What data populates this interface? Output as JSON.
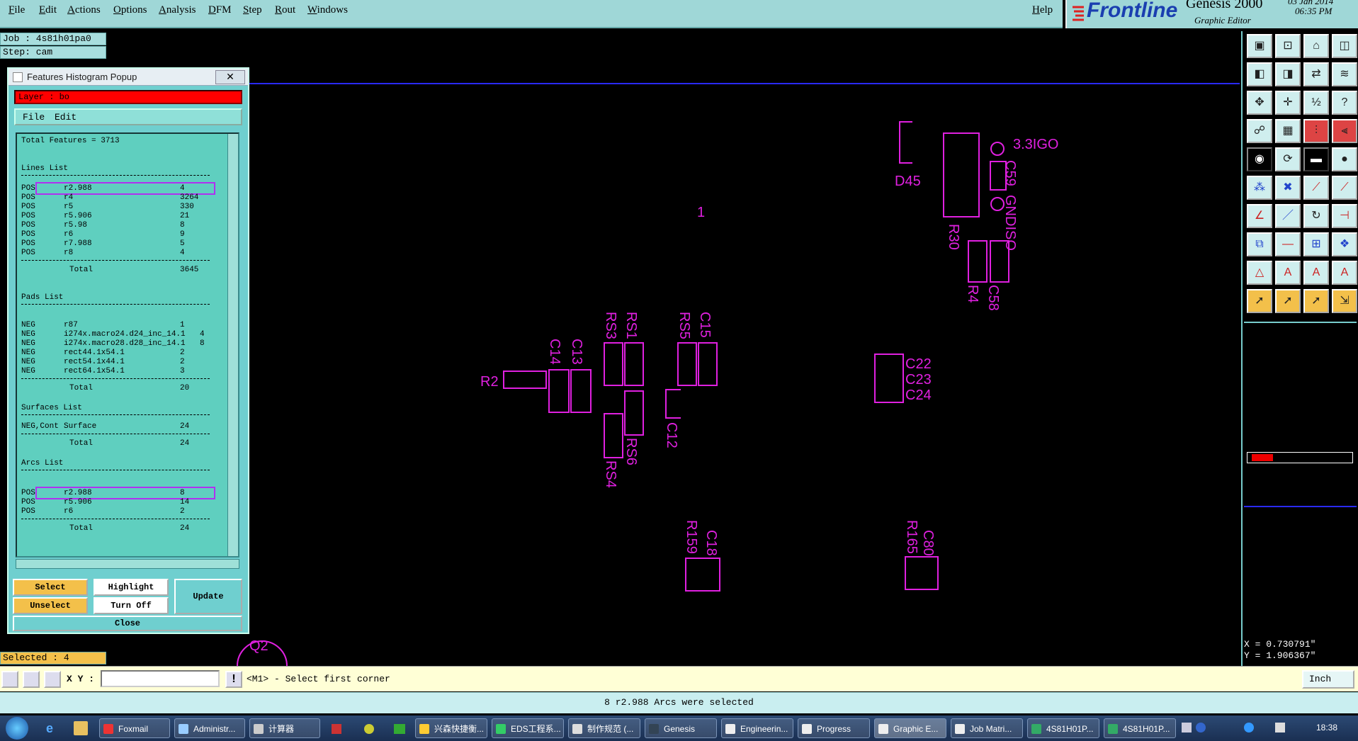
{
  "menu": {
    "items": [
      "File",
      "Edit",
      "Actions",
      "Options",
      "Analysis",
      "DFM",
      "Step",
      "Rout",
      "Windows"
    ],
    "help": "Help"
  },
  "brand": {
    "logo": "Frontline",
    "product": "Genesis 2000",
    "subtitle": "Graphic Editor",
    "date": "03 Jan 2014",
    "time": "06:35 PM"
  },
  "job": {
    "job_label": "Job : 4s81h01pa0",
    "step_label": "Step: cam"
  },
  "popup": {
    "title": "Features Histogram Popup",
    "close_glyph": "✕",
    "layer": "Layer :  bo",
    "menu": [
      "File",
      "Edit"
    ],
    "total_features": "Total Features = 3713",
    "lines_title": "Lines List",
    "lines": [
      {
        "pol": "POS",
        "sym": "r2.988",
        "count": "4"
      },
      {
        "pol": "POS",
        "sym": "r4",
        "count": "3264"
      },
      {
        "pol": "POS",
        "sym": "r5",
        "count": "330"
      },
      {
        "pol": "POS",
        "sym": "r5.906",
        "count": "21"
      },
      {
        "pol": "POS",
        "sym": "r5.98",
        "count": "8"
      },
      {
        "pol": "POS",
        "sym": "r6",
        "count": "9"
      },
      {
        "pol": "POS",
        "sym": "r7.988",
        "count": "5"
      },
      {
        "pol": "POS",
        "sym": "r8",
        "count": "4"
      }
    ],
    "lines_total": "3645",
    "pads_title": "Pads List",
    "pads": [
      {
        "pol": "NEG",
        "sym": "r87",
        "count": "1"
      },
      {
        "pol": "NEG",
        "sym": "i274x.macro24.d24_inc_14.1",
        "count": "4"
      },
      {
        "pol": "NEG",
        "sym": "i274x.macro28.d28_inc_14.1",
        "count": "8"
      },
      {
        "pol": "NEG",
        "sym": "rect44.1x54.1",
        "count": "2"
      },
      {
        "pol": "NEG",
        "sym": "rect54.1x44.1",
        "count": "2"
      },
      {
        "pol": "NEG",
        "sym": "rect64.1x54.1",
        "count": "3"
      }
    ],
    "pads_total": "20",
    "surfaces_title": "Surfaces List",
    "surfaces": [
      {
        "pol": "NEG,Cont",
        "sym": "Surface",
        "count": "24"
      }
    ],
    "surfaces_total": "24",
    "arcs_title": "Arcs List",
    "arcs": [
      {
        "pol": "POS",
        "sym": "r2.988",
        "count": "8"
      },
      {
        "pol": "POS",
        "sym": "r5.906",
        "count": "14"
      },
      {
        "pol": "POS",
        "sym": "r6",
        "count": "2"
      }
    ],
    "arcs_total": "24",
    "total_label": "Total",
    "buttons": {
      "select": "Select",
      "highlight": "Highlight",
      "update": "Update",
      "unselect": "Unselect",
      "turn_off": "Turn Off",
      "close": "Close"
    }
  },
  "selected": "Selected : 4",
  "coords": {
    "x": "X = 0.730791\"",
    "y": "Y = 1.906367\""
  },
  "command": {
    "xy_label": "X Y :",
    "xy_value": "",
    "prompt": "<M1> - Select first corner",
    "units": "Inch"
  },
  "message": "8 r2.988 Arcs were selected",
  "canvas_labels": {
    "marker_top": "1",
    "part_d45": "D45",
    "part_3310": "3.3IGO",
    "part_c59": "C59",
    "part_gndiso": "GNDISO",
    "part_r30": "R30",
    "part_r4": "R4",
    "part_c58": "C58",
    "part_rs3": "RS3",
    "part_rs1": "RS1",
    "part_rs5": "RS5",
    "part_c15": "C15",
    "part_c14": "C14",
    "part_c13": "C13",
    "part_r2": "R2",
    "part_c12": "C12",
    "part_rs4": "RS4",
    "part_rs6": "RS6",
    "part_c22": "C22",
    "part_c23": "C23",
    "part_c24": "C24",
    "part_r159": "R159",
    "part_c18": "C18",
    "part_r165": "R165",
    "part_c80": "C80",
    "part_q2": "Q2"
  },
  "taskbar": {
    "items": [
      "Foxmail",
      "Administr...",
      "计算器",
      "兴森快捷衡...",
      "EDS工程系...",
      "制作规范 (...",
      "Genesis",
      "Engineerin...",
      "Progress",
      "Graphic E...",
      "Job Matri...",
      "4S81H01P...",
      "4S81H01P..."
    ],
    "clock": "18:38"
  },
  "colors": {
    "accent": "#9fd7d7",
    "layer": "#e020e0",
    "panel": "#6fcfcf",
    "selected_layer": "#ff0000"
  }
}
